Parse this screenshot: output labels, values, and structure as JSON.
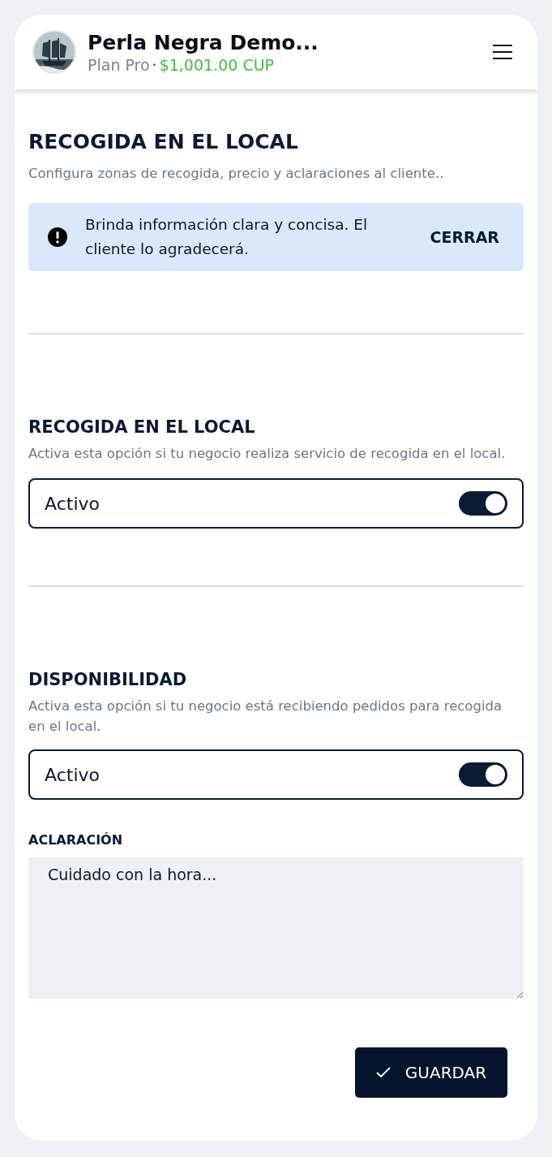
{
  "header": {
    "business_name": "Perla Negra Demo...",
    "plan": "Plan Pro",
    "separator": "·",
    "balance": "$1,001.00 CUP"
  },
  "page": {
    "title": "RECOGIDA EN EL LOCAL",
    "subtitle": "Configura zonas de recogida, precio y aclaraciones al cliente.."
  },
  "alert": {
    "message": "Brinda información clara y concisa. El cliente lo agradecerá.",
    "action": "CERRAR"
  },
  "sections": [
    {
      "title": "RECOGIDA EN EL LOCAL",
      "description": "Activa esta opción si tu negocio realiza servicio de recogida en el local.",
      "toggle": {
        "label": "Activo",
        "on": true
      }
    },
    {
      "title": "DISPONIBILIDAD",
      "description": "Activa esta opción si tu negocio está recibiendo pedidos para recogida en el local.",
      "toggle": {
        "label": "Activo",
        "on": true
      }
    }
  ],
  "clarification": {
    "label": "ACLARACIÓN",
    "value": "Cuidado con la hora..."
  },
  "save_button": {
    "label": "GUARDAR"
  }
}
